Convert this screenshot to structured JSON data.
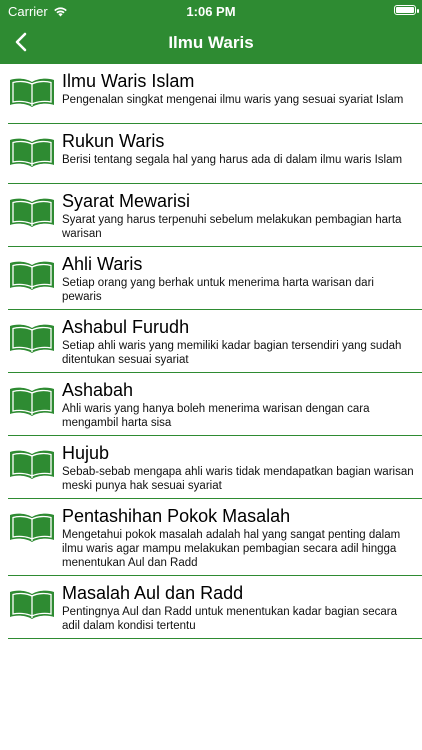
{
  "status": {
    "carrier": "Carrier",
    "time": "1:06 PM"
  },
  "nav": {
    "title": "Ilmu Waris"
  },
  "colors": {
    "accent": "#2e8b32"
  },
  "items": [
    {
      "title": "Ilmu Waris Islam",
      "desc": "Pengenalan singkat mengenai ilmu waris yang sesuai syariat Islam",
      "icon": "book-icon"
    },
    {
      "title": "Rukun Waris",
      "desc": "Berisi tentang segala hal yang harus ada di dalam ilmu waris Islam",
      "icon": "book-icon"
    },
    {
      "title": "Syarat Mewarisi",
      "desc": "Syarat yang harus terpenuhi sebelum melakukan pembagian harta warisan",
      "icon": "book-icon"
    },
    {
      "title": "Ahli Waris",
      "desc": "Setiap orang yang berhak untuk menerima harta warisan dari pewaris",
      "icon": "book-icon"
    },
    {
      "title": "Ashabul Furudh",
      "desc": "Setiap ahli waris yang memiliki kadar bagian tersendiri yang sudah ditentukan sesuai syariat",
      "icon": "book-icon"
    },
    {
      "title": "Ashabah",
      "desc": "Ahli waris yang hanya boleh menerima warisan dengan cara mengambil harta sisa",
      "icon": "book-icon"
    },
    {
      "title": "Hujub",
      "desc": "Sebab-sebab mengapa ahli waris tidak mendapatkan bagian warisan meski punya hak sesuai syariat",
      "icon": "book-icon"
    },
    {
      "title": "Pentashihan Pokok Masalah",
      "desc": "Mengetahui pokok masalah adalah hal yang sangat penting dalam ilmu waris agar mampu melakukan pembagian secara adil hingga menentukan Aul dan Radd",
      "icon": "book-icon"
    },
    {
      "title": "Masalah Aul dan Radd",
      "desc": "Pentingnya Aul dan Radd untuk menentukan kadar bagian secara adil dalam kondisi tertentu",
      "icon": "book-icon"
    }
  ]
}
